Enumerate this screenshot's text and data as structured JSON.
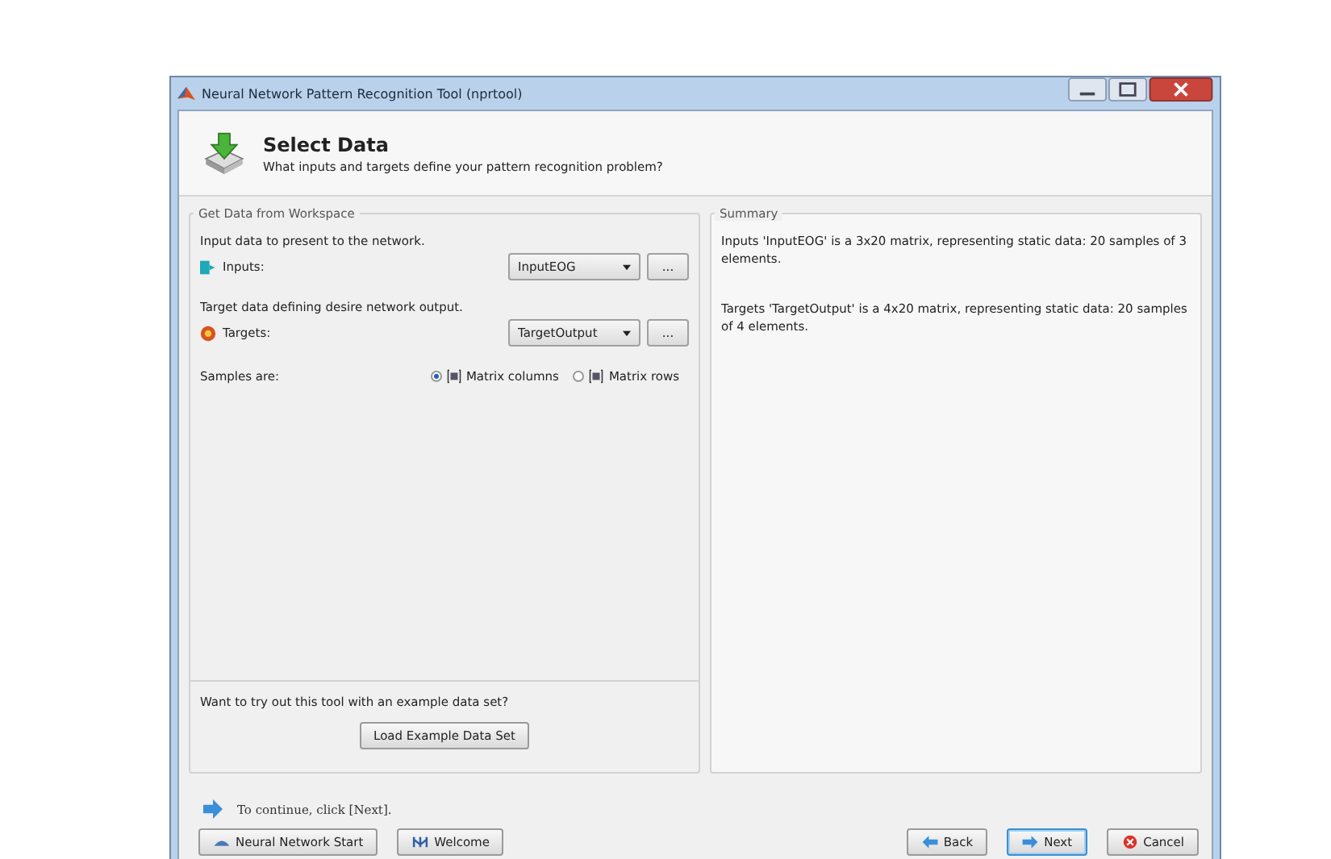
{
  "window": {
    "title": "Neural Network Pattern Recognition Tool (nprtool)"
  },
  "header": {
    "title": "Select Data",
    "subtitle": "What inputs and targets define your pattern recognition problem?"
  },
  "workspace": {
    "title": "Get Data from Workspace",
    "inputs": {
      "description": "Input data to present to the network.",
      "label": "Inputs:",
      "value": "InputEOG",
      "browse": "..."
    },
    "targets": {
      "description": "Target data defining desire network output.",
      "label": "Targets:",
      "value": "TargetOutput",
      "browse": "..."
    },
    "samples": {
      "label": "Samples are:",
      "options": [
        {
          "label": "Matrix columns",
          "selected": true
        },
        {
          "label": "Matrix rows",
          "selected": false
        }
      ]
    },
    "example": {
      "prompt": "Want to try out this tool with an example data set?",
      "button": "Load Example Data Set"
    }
  },
  "summary": {
    "title": "Summary",
    "lines": [
      "Inputs 'InputEOG' is a 3x20 matrix, representing static data: 20 samples of 3 elements.",
      "Targets 'TargetOutput' is a 4x20 matrix, representing static data: 20 samples of 4 elements."
    ]
  },
  "hint": "To continue, click [Next].",
  "buttons": [
    {
      "kind": "start",
      "label": "Neural Network Start"
    },
    {
      "kind": "welcome",
      "label": "Welcome"
    },
    {
      "kind": "back",
      "label": "Back"
    },
    {
      "kind": "next",
      "label": "Next"
    },
    {
      "kind": "cancel",
      "label": "Cancel"
    }
  ]
}
